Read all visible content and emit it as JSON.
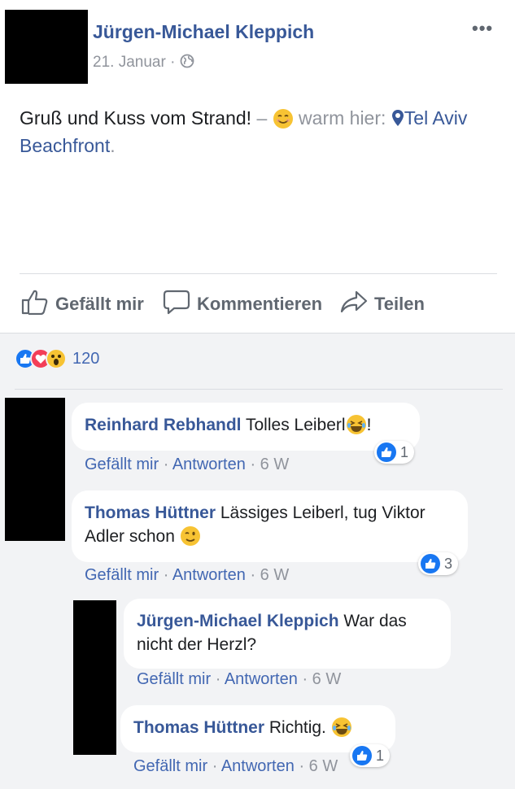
{
  "post": {
    "author": "Jürgen-Michael Kleppich",
    "date": "21. Januar",
    "separator": "·",
    "more_label": "•••",
    "text_main": "Gruß und Kuss vom Strand!",
    "text_dash": " – ",
    "feeling": " warm hier: ",
    "location": "Tel Aviv Beachfront",
    "period": "."
  },
  "actions": {
    "like": "Gefällt mir",
    "comment": "Kommentieren",
    "share": "Teilen"
  },
  "reactions": {
    "count": "120",
    "types": [
      "like-icon",
      "love-icon",
      "wow-icon"
    ]
  },
  "comments": [
    {
      "author": "Reinhard Rebhandl",
      "text": "Tolles Leiberl",
      "text_after": "!",
      "like": "Gefällt mir",
      "reply": "Antworten",
      "age": "6 W",
      "likes": "1"
    },
    {
      "author": "Thomas Hüttner",
      "text": "Lässiges Leiberl, tug Viktor Adler schon ",
      "like": "Gefällt mir",
      "reply": "Antworten",
      "age": "6 W",
      "likes": "3"
    },
    {
      "author": "Jürgen-Michael Kleppich",
      "text": "War das nicht der Herzl?",
      "like": "Gefällt mir",
      "reply": "Antworten",
      "age": "6 W"
    },
    {
      "author": "Thomas Hüttner",
      "text": "Richtig. ",
      "like": "Gefällt mir",
      "reply": "Antworten",
      "age": "6 W",
      "likes": "1"
    }
  ],
  "colors": {
    "link": "#385898",
    "action_blue": "#4267b2",
    "muted": "#90949c",
    "comment_bg": "#f2f3f5",
    "like_blue": "#1877f2"
  }
}
